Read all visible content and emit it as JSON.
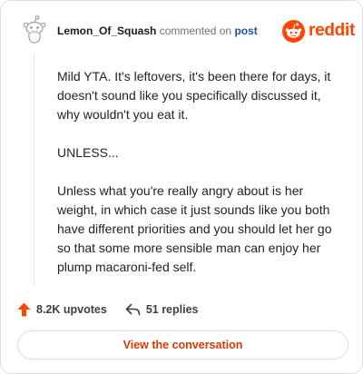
{
  "comment": {
    "author": "Lemon_Of_Squash",
    "action_text": "commented on",
    "post_link_label": "post",
    "paragraphs": [
      "Mild YTA. It's leftovers, it's been there for days, it doesn't sound like you specifically discussed it, why wouldn't you eat it.",
      "UNLESS...",
      "Unless what you're really angry about is her weight, in which case it just sounds like you both have different priorities and you should let her go so that some more sensible man can enjoy her plump macaroni-fed self."
    ]
  },
  "brand": {
    "name": "reddit",
    "icon": "reddit-logo-icon",
    "color": "#ff4500"
  },
  "stats": {
    "upvotes": "8.2K upvotes",
    "upvote_icon": "upvote-arrow-icon",
    "replies": "51 replies",
    "reply_icon": "reply-arrow-icon"
  },
  "cta": {
    "label": "View the conversation",
    "color": "#d93a00"
  }
}
